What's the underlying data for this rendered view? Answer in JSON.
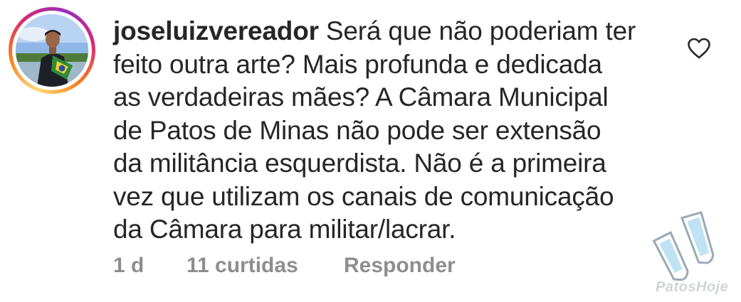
{
  "comment": {
    "username": "joseluizvereador",
    "lines": [
      "Será que não poderiam ter",
      "feito outra arte? Mais profunda e dedicada",
      "as verdadeiras mães? A Câmara Municipal",
      "de Patos de Minas não pode ser extensão",
      "da militância esquerdista. Não é a primeira",
      "vez que utilizam os canais de comunicação",
      "da Câmara para militar/lacrar."
    ],
    "time": "1 d",
    "likes": "11 curtidas",
    "reply": "Responder"
  },
  "icons": {
    "like": "heart-outline-icon",
    "watermark": "fins-logo"
  },
  "watermark": {
    "text": "PatosHoje"
  },
  "colors": {
    "text": "#262626",
    "meta": "#8e8e8e",
    "background": "#ffffff",
    "ring_start": "#feda75",
    "ring_end": "#d62976"
  }
}
